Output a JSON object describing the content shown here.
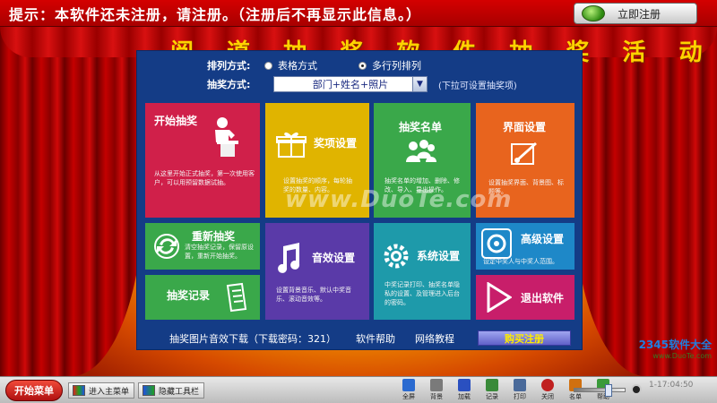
{
  "notice": {
    "text": "提示：本软件还未注册，请注册。（注册后不再显示此信息。）",
    "register_button": "立即注册"
  },
  "event_title": "阅 道 抽 奖 软 件 抽 奖 活 动",
  "options": {
    "layout_label": "排列方式:",
    "layout_table": "表格方式",
    "layout_multirow": "多行列排列",
    "selected_layout": "多行列排列",
    "mode_label": "抽奖方式:",
    "mode_value": "部门+姓名+照片",
    "mode_hint": "(下拉可设置抽奖项)"
  },
  "tiles": {
    "start": {
      "title": "开始抽奖",
      "desc": "从这里开始正式抽奖，第一次使用客户，可以用预留数据试抽。"
    },
    "prize": {
      "title": "奖项设置",
      "desc": "设置抽奖的顺序，每轮抽奖的数量、内容。"
    },
    "roster": {
      "title": "抽奖名单",
      "desc": "抽奖名单的增加、删除、修改、导入、导出操作。"
    },
    "ui": {
      "title": "界面设置",
      "desc": "设置抽奖界面、背景图、标题等。"
    },
    "redraw": {
      "title": "重新抽奖",
      "desc": "清空抽奖记录，保留原设置，重新开始抽奖。"
    },
    "sound": {
      "title": "音效设置",
      "desc": "设置背景音乐、默认中奖音乐、滚动音效等。"
    },
    "system": {
      "title": "系统设置",
      "desc": "中奖记录打印、抽奖名单隐私的设置、及管理进入后台的密码。"
    },
    "advanced": {
      "title": "高级设置",
      "desc": "设定中奖人与中奖人范围。"
    },
    "records": {
      "title": "抽奖记录"
    },
    "exit": {
      "title": "退出软件"
    }
  },
  "bottom": {
    "download": "抽奖图片音效下载（下载密码：321）",
    "help": "软件帮助",
    "tutorial": "网络教程",
    "buy": "购买注册"
  },
  "watermark": "www.DuoTe.com",
  "brand": {
    "name": "2345软件大全",
    "url": "www.DuoTe.com"
  },
  "taskbar": {
    "start": "开始菜单",
    "main_menu": "进入主菜单",
    "hide_toolbar": "隐藏工具栏",
    "tools": [
      {
        "label": "全屏",
        "color": "#2a6ad0"
      },
      {
        "label": "背景",
        "color": "#7a7a7a"
      },
      {
        "label": "加载",
        "color": "#2a50c0"
      },
      {
        "label": "记录",
        "color": "#3a8a3a"
      },
      {
        "label": "打印",
        "color": "#4a6a9a"
      },
      {
        "label": "关闭",
        "color": "#c02020"
      },
      {
        "label": "名单",
        "color": "#d07010"
      },
      {
        "label": "帮助",
        "color": "#3a9a3a"
      }
    ],
    "clock": [
      "1-17:04:50"
    ]
  }
}
